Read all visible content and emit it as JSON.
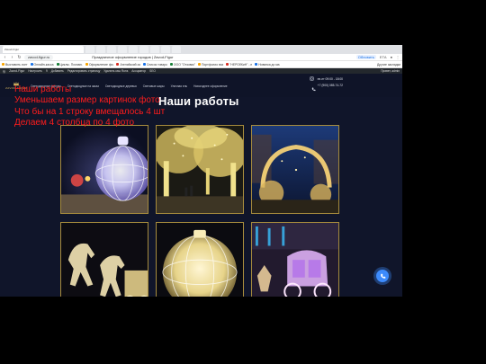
{
  "browser": {
    "window_title": "Праздничное оформление городов | Zavod-Figur",
    "address": "zavod-figur.ru",
    "tabs": [
      "Zavod-Figur",
      "",
      "",
      "",
      "",
      "",
      "",
      "",
      "",
      ""
    ],
    "bookmarks": [
      "Выставить счет",
      "Онлайн-касса",
      "Циклы. Познаю.",
      "Оформление фи.",
      "Английский за",
      "Список товаро",
      "ООО \"Отзовик\"",
      "Портфолио вза",
      "\"НЕРОбКиН\" - п",
      "Новинка до ма",
      "Другие закладки"
    ],
    "top_right": [
      "Обновить",
      "ЕТА"
    ]
  },
  "wp_admin_bar": {
    "items": [
      "Zavod-Figur",
      "Настроить",
      "9",
      "Добавить",
      "Редактировать страницу",
      "Удалить кэш Runs",
      "Асоциатор",
      "SEO"
    ],
    "right": "Привет, admin"
  },
  "site": {
    "logo_text": "ZAVOD-FIGUR",
    "nav": [
      "Светодиодные фигуры",
      "Светодиодные на заказ",
      "Светодиодные деревья",
      "Световые шары",
      "Уличная ель",
      "Новогоднее оформление"
    ],
    "contact_hours": "пн-пт 09:00 - 18:00",
    "contact_phone": "+7 (900) 085-74-72",
    "title": "Наши работы"
  },
  "gallery": {
    "photos": [
      "lit-ball-sculpture",
      "tree-tunnel",
      "glowing-carriage-scene",
      "light-horses",
      "giant-light-ball",
      "cinderella-carriage"
    ]
  },
  "annotation": {
    "lines": [
      "Наши работы",
      "Уменьшаем размер картинок фото",
      "Что бы на 1 строку вмещалось 4 шт",
      "Делаем 4 столбца по 4 фото"
    ],
    "color": "#ff1c1c"
  },
  "colors": {
    "site_bg": "#10152a",
    "gold": "#a78c3d",
    "call_button": "#3d8bfd"
  }
}
